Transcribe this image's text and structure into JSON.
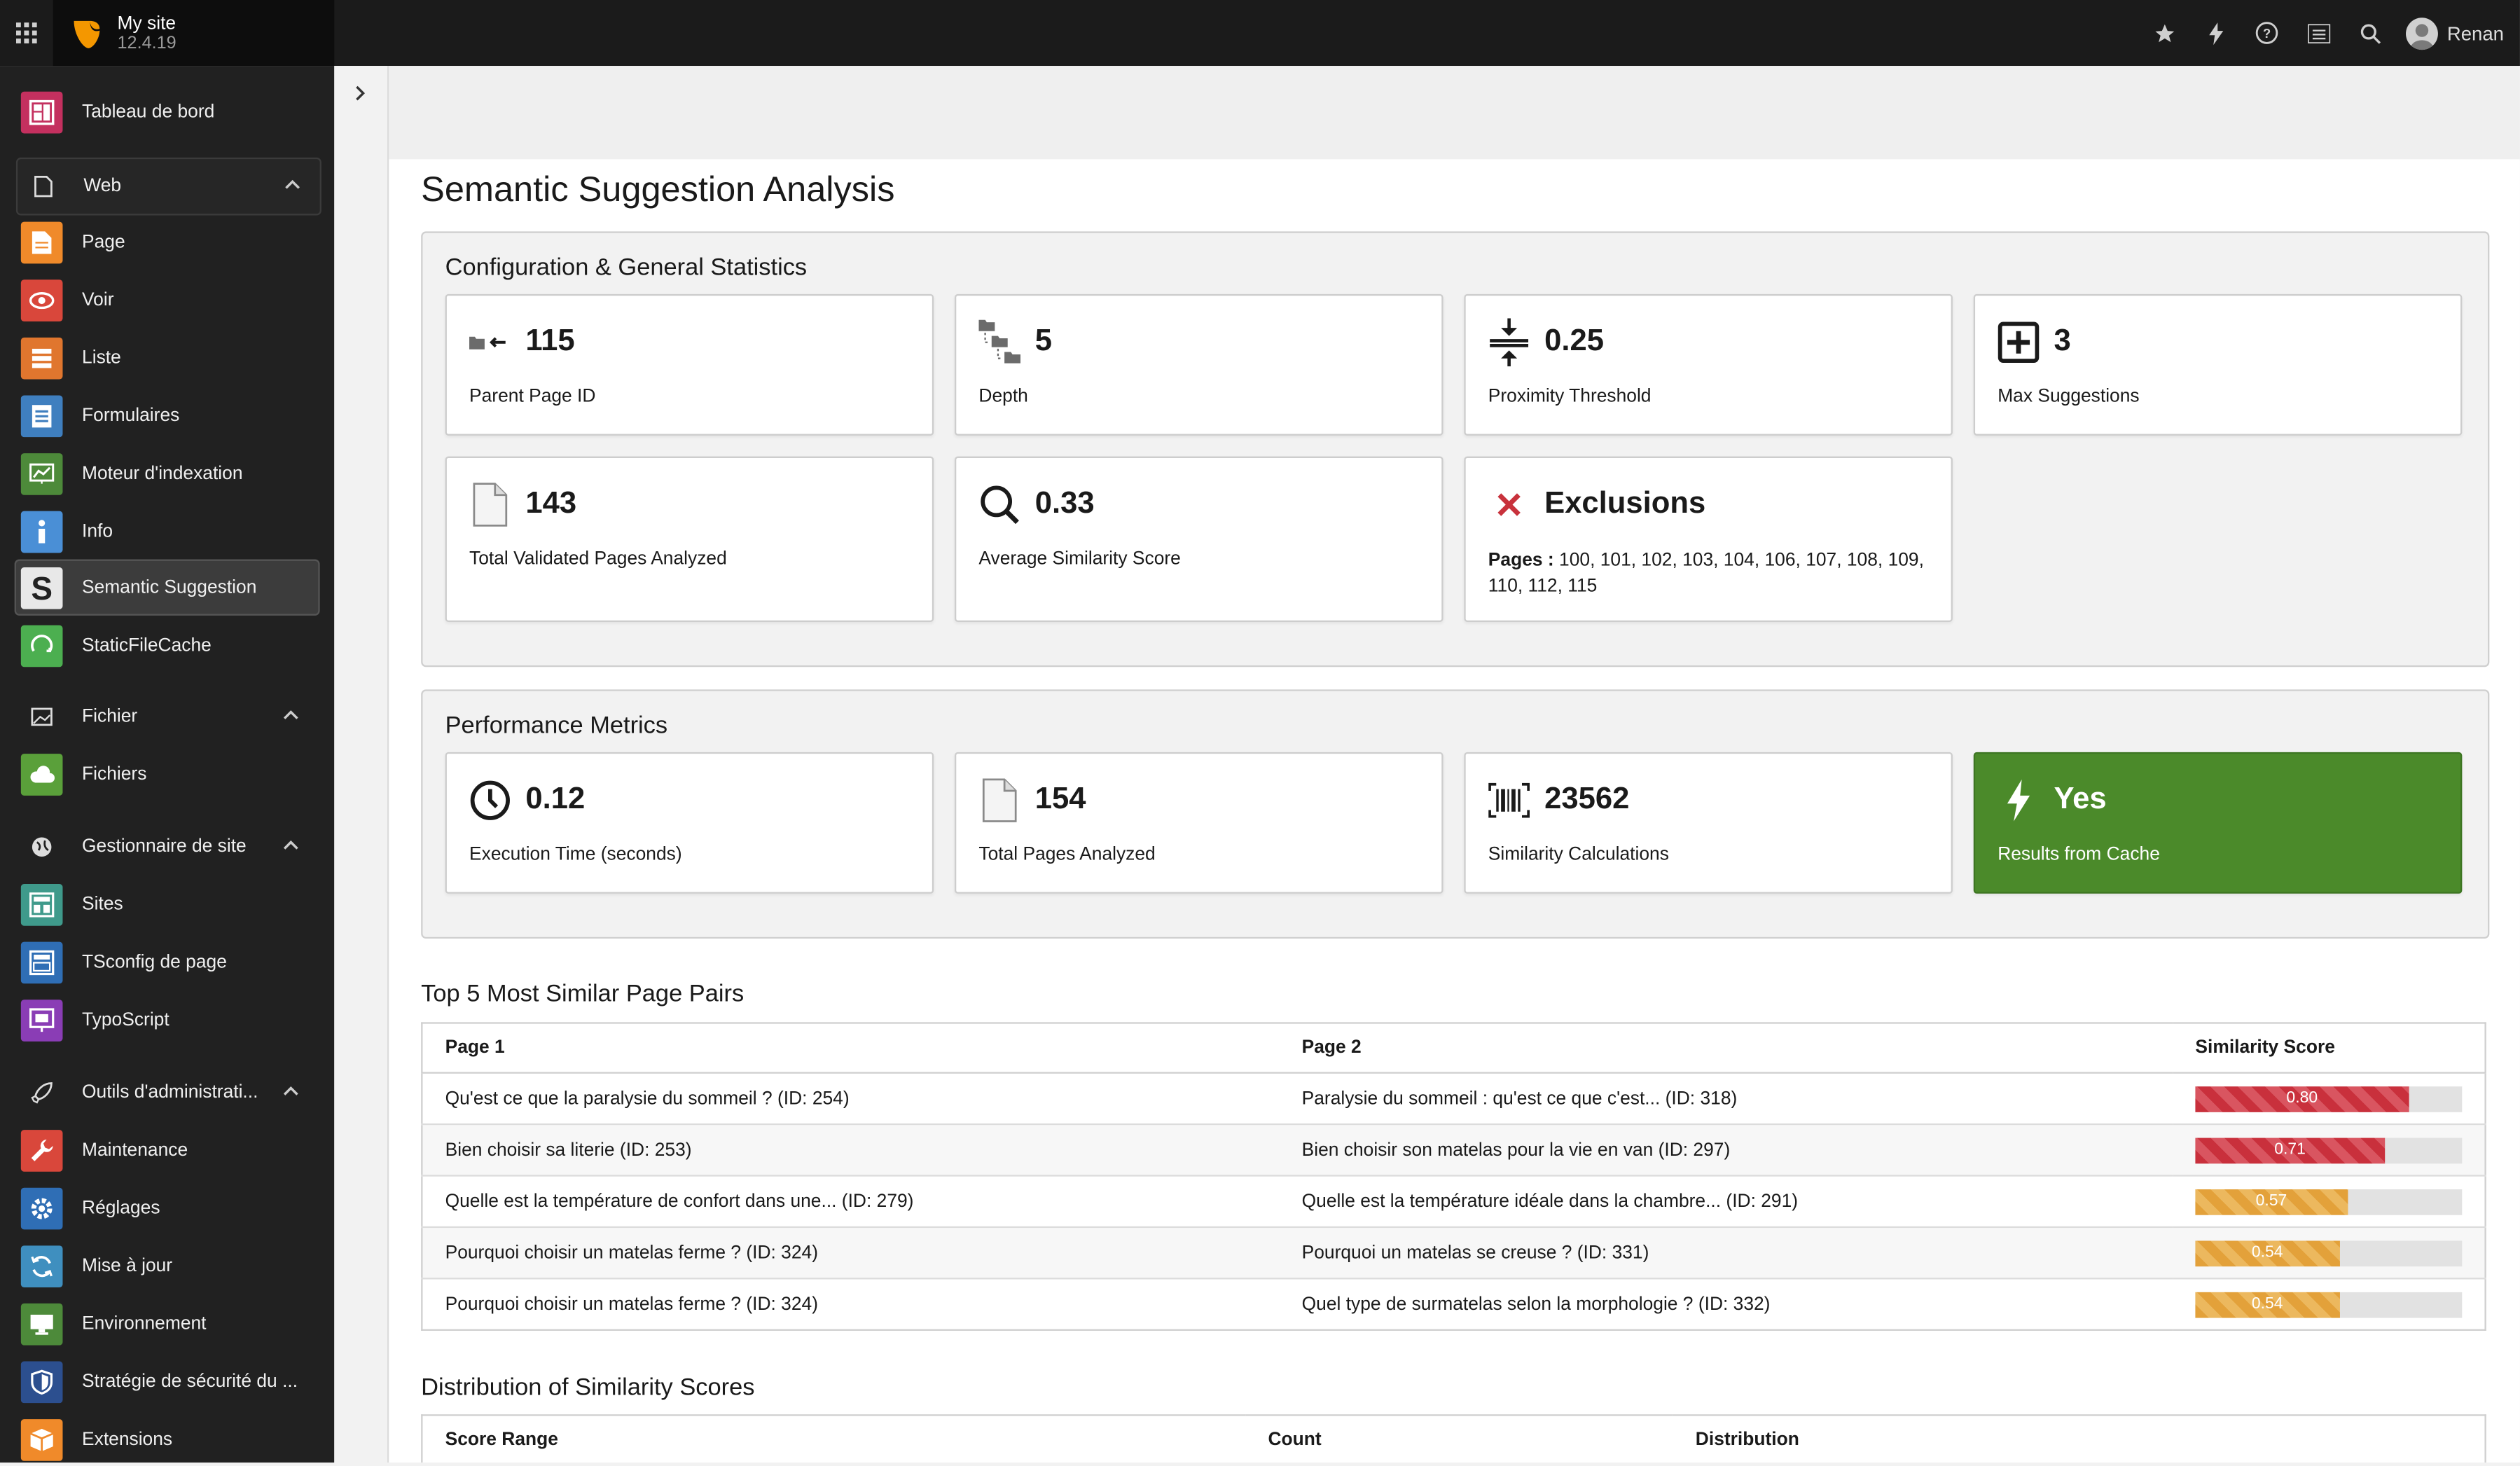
{
  "topbar": {
    "site_name": "My site",
    "version": "12.4.19",
    "user_name": "Renan",
    "icons": [
      "apps-grid-icon",
      "star-icon",
      "bolt-icon",
      "help-icon",
      "list-icon",
      "search-icon"
    ]
  },
  "sidebar": {
    "dashboard": "Tableau de bord",
    "groups": {
      "web": "Web",
      "file": "Fichier",
      "site": "Gestionnaire de site",
      "admin": "Outils d'administrati..."
    },
    "web_items": [
      "Page",
      "Voir",
      "Liste",
      "Formulaires",
      "Moteur d'indexation",
      "Info",
      "Semantic Suggestion",
      "StaticFileCache"
    ],
    "file_items": [
      "Fichiers"
    ],
    "site_items": [
      "Sites",
      "TSconfig de page",
      "TypoScript"
    ],
    "admin_items": [
      "Maintenance",
      "Réglages",
      "Mise à jour",
      "Environnement",
      "Stratégie de sécurité du ...",
      "Extensions"
    ],
    "active": "Semantic Suggestion"
  },
  "page": {
    "title": "Semantic Suggestion Analysis"
  },
  "config": {
    "title": "Configuration & General Statistics",
    "parent_page_id": {
      "value": "115",
      "label": "Parent Page ID"
    },
    "depth": {
      "value": "5",
      "label": "Depth"
    },
    "proximity": {
      "value": "0.25",
      "label": "Proximity Threshold"
    },
    "max_suggestions": {
      "value": "3",
      "label": "Max Suggestions"
    },
    "total_validated": {
      "value": "143",
      "label": "Total Validated Pages Analyzed"
    },
    "avg_score": {
      "value": "0.33",
      "label": "Average Similarity Score"
    },
    "exclusions": {
      "value": "Exclusions",
      "prefix": "Pages :",
      "pages": "100, 101, 102, 103, 104, 106, 107, 108, 109, 110, 112, 115"
    }
  },
  "performance": {
    "title": "Performance Metrics",
    "exec_time": {
      "value": "0.12",
      "label": "Execution Time (seconds)"
    },
    "total_pages": {
      "value": "154",
      "label": "Total Pages Analyzed"
    },
    "calculations": {
      "value": "23562",
      "label": "Similarity Calculations"
    },
    "cache": {
      "value": "Yes",
      "label": "Results from Cache",
      "color": "#4b8a2a"
    }
  },
  "top_pairs": {
    "title": "Top 5 Most Similar Page Pairs",
    "headers": [
      "Page 1",
      "Page 2",
      "Similarity Score"
    ],
    "rows": [
      {
        "page1": "Qu'est ce que la paralysie du sommeil ? (ID: 254)",
        "page2": "Paralysie du sommeil : qu'est ce que c'est... (ID: 318)",
        "score": 0.8,
        "score_label": "0.80",
        "level": "red"
      },
      {
        "page1": "Bien choisir sa literie (ID: 253)",
        "page2": "Bien choisir son matelas pour la vie en van (ID: 297)",
        "score": 0.71,
        "score_label": "0.71",
        "level": "red"
      },
      {
        "page1": "Quelle est la température de confort dans une... (ID: 279)",
        "page2": "Quelle est la température idéale dans la chambre... (ID: 291)",
        "score": 0.57,
        "score_label": "0.57",
        "level": "orange"
      },
      {
        "page1": "Pourquoi choisir un matelas ferme ? (ID: 324)",
        "page2": "Pourquoi un matelas se creuse ? (ID: 331)",
        "score": 0.54,
        "score_label": "0.54",
        "level": "orange"
      },
      {
        "page1": "Pourquoi choisir un matelas ferme ? (ID: 324)",
        "page2": "Quel type de surmatelas selon la morphologie ? (ID: 332)",
        "score": 0.54,
        "score_label": "0.54",
        "level": "orange"
      }
    ]
  },
  "distribution": {
    "title": "Distribution of Similarity Scores",
    "headers": [
      "Score Range",
      "Count",
      "Distribution"
    ]
  }
}
